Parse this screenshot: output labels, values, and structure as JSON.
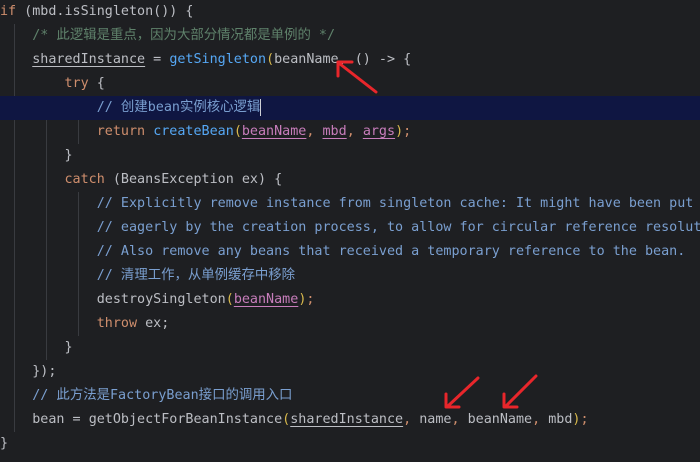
{
  "code": {
    "l1": {
      "kw": "if",
      "rest": " (mbd.isSingleton()) {"
    },
    "l2": {
      "comment": "/* 此逻辑是重点，因为大部分情况都是单例的 */"
    },
    "l3": {
      "var": "sharedInstance",
      "eq": " = ",
      "fn": "getSingleton",
      "open": "(",
      "arg": "beanName",
      "rest": ", () -> {"
    },
    "l4": {
      "kw": "try",
      "rest": " {"
    },
    "l5": {
      "comment": "// 创建bean实例核心逻辑"
    },
    "l6": {
      "kw": "return",
      "fn": "createBean",
      "a1": "beanName",
      "a2": "mbd",
      "a3": "args",
      "sep": ", ",
      "close": ");"
    },
    "l7": {
      "text": "}"
    },
    "l8": {
      "kw": "catch",
      "rest": " (BeansException ex) {"
    },
    "l9": {
      "comment": "// Explicitly remove instance from singleton cache: It might have been put there"
    },
    "l10": {
      "comment": "// eagerly by the creation process, to allow for circular reference resolution."
    },
    "l11": {
      "comment": "// Also remove any beans that received a temporary reference to the bean."
    },
    "l12": {
      "comment": "// 清理工作，从单例缓存中移除"
    },
    "l13": {
      "fn": "destroySingleton",
      "arg": "beanName",
      "close": ");"
    },
    "l14": {
      "kw": "throw",
      "rest": " ex;"
    },
    "l15": {
      "text": "}"
    },
    "l16": {
      "text": "});"
    },
    "l17": {
      "comment": "// 此方法是FactoryBean接口的调用入口"
    },
    "l18": {
      "lhs": "bean",
      "eq": " = ",
      "fn": "getObjectForBeanInstance",
      "a1": "sharedInstance",
      "a2": "name",
      "a3": "beanName",
      "a4": "mbd",
      "sep": ", ",
      "close": ");"
    },
    "l19": {
      "text": "}"
    }
  },
  "annotations": {
    "arrow_color": "#e8262b",
    "arrow_count": 3
  }
}
